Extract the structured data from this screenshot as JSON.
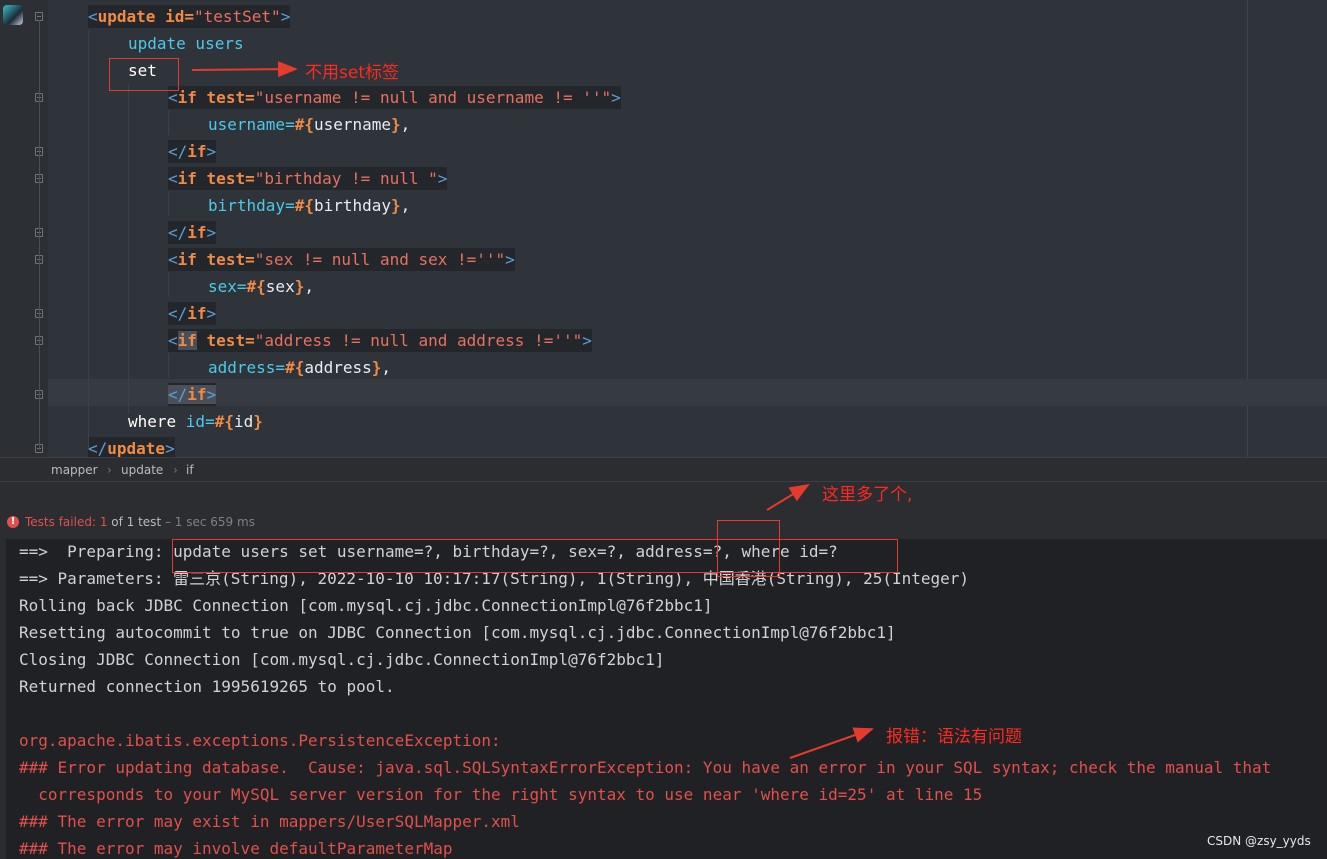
{
  "editor": {
    "lines": [
      {
        "parts": [
          {
            "t": "<",
            "c": "t-br"
          },
          {
            "t": "update ",
            "c": "t-tag"
          },
          {
            "t": "id=",
            "c": "t-tag"
          },
          {
            "t": "\"testSet\"",
            "c": "t-str"
          },
          {
            "t": ">",
            "c": "t-br"
          }
        ]
      },
      {
        "parts": [
          {
            "t": "update users",
            "c": "t-kw"
          }
        ]
      },
      {
        "parts": [
          {
            "t": "set",
            "c": "t-wh"
          }
        ]
      },
      {
        "parts": [
          {
            "t": "<",
            "c": "t-br"
          },
          {
            "t": "if ",
            "c": "t-tag"
          },
          {
            "t": "test=",
            "c": "t-tag"
          },
          {
            "t": "\"username != null and username != ''\"",
            "c": "t-str"
          },
          {
            "t": ">",
            "c": "t-br"
          }
        ]
      },
      {
        "parts": [
          {
            "t": "username=",
            "c": "t-kw"
          },
          {
            "t": "#{",
            "c": "t-tag"
          },
          {
            "t": "username",
            "c": "t-var"
          },
          {
            "t": "}",
            "c": "t-tag"
          },
          {
            "t": ",",
            "c": "t-var"
          }
        ]
      },
      {
        "parts": [
          {
            "t": "</",
            "c": "t-br"
          },
          {
            "t": "if",
            "c": "t-tag"
          },
          {
            "t": ">",
            "c": "t-br"
          }
        ]
      },
      {
        "parts": [
          {
            "t": "<",
            "c": "t-br"
          },
          {
            "t": "if ",
            "c": "t-tag"
          },
          {
            "t": "test=",
            "c": "t-tag"
          },
          {
            "t": "\"birthday != null \"",
            "c": "t-str"
          },
          {
            "t": ">",
            "c": "t-br"
          }
        ]
      },
      {
        "parts": [
          {
            "t": "birthday=",
            "c": "t-kw"
          },
          {
            "t": "#{",
            "c": "t-tag"
          },
          {
            "t": "birthday",
            "c": "t-var"
          },
          {
            "t": "}",
            "c": "t-tag"
          },
          {
            "t": ",",
            "c": "t-var"
          }
        ]
      },
      {
        "parts": [
          {
            "t": "</",
            "c": "t-br"
          },
          {
            "t": "if",
            "c": "t-tag"
          },
          {
            "t": ">",
            "c": "t-br"
          }
        ]
      },
      {
        "parts": [
          {
            "t": "<",
            "c": "t-br"
          },
          {
            "t": "if ",
            "c": "t-tag"
          },
          {
            "t": "test=",
            "c": "t-tag"
          },
          {
            "t": "\"sex != null and sex !=''\"",
            "c": "t-str"
          },
          {
            "t": ">",
            "c": "t-br"
          }
        ]
      },
      {
        "parts": [
          {
            "t": "sex=",
            "c": "t-kw"
          },
          {
            "t": "#{",
            "c": "t-tag"
          },
          {
            "t": "sex",
            "c": "t-var"
          },
          {
            "t": "}",
            "c": "t-tag"
          },
          {
            "t": ",",
            "c": "t-var"
          }
        ]
      },
      {
        "parts": [
          {
            "t": "</",
            "c": "t-br"
          },
          {
            "t": "if",
            "c": "t-tag"
          },
          {
            "t": ">",
            "c": "t-br"
          }
        ]
      },
      {
        "parts": [
          {
            "t": "<",
            "c": "t-br"
          },
          {
            "t": "if",
            "c": "t-tag t-hl"
          },
          {
            "t": " test=",
            "c": "t-tag"
          },
          {
            "t": "\"address != null and address !=''\"",
            "c": "t-str"
          },
          {
            "t": ">",
            "c": "t-br"
          }
        ]
      },
      {
        "parts": [
          {
            "t": "address=",
            "c": "t-kw"
          },
          {
            "t": "#{",
            "c": "t-tag"
          },
          {
            "t": "address",
            "c": "t-var"
          },
          {
            "t": "}",
            "c": "t-tag"
          },
          {
            "t": ",",
            "c": "t-var"
          }
        ]
      },
      {
        "parts": [
          {
            "t": "</",
            "c": "t-br t-hl"
          },
          {
            "t": "if",
            "c": "t-tag t-hl"
          },
          {
            "t": ">",
            "c": "t-br t-hl"
          }
        ]
      },
      {
        "parts": [
          {
            "t": "where ",
            "c": "t-wh"
          },
          {
            "t": "id=",
            "c": "t-kw"
          },
          {
            "t": "#{",
            "c": "t-tag"
          },
          {
            "t": "id",
            "c": "t-var"
          },
          {
            "t": "}",
            "c": "t-tag"
          }
        ]
      },
      {
        "parts": [
          {
            "t": "</",
            "c": "t-br"
          },
          {
            "t": "update",
            "c": "t-tag"
          },
          {
            "t": ">",
            "c": "t-br"
          }
        ]
      }
    ]
  },
  "breadcrumb": {
    "items": [
      "mapper",
      "update",
      "if"
    ]
  },
  "testbar": {
    "status": "Tests failed: ",
    "count": "1",
    "of": " of 1 test",
    "time": " – 1 sec 659 ms"
  },
  "console": {
    "lines": [
      {
        "text": "==>  Preparing: update users set username=?, birthday=?, sex=?, address=?, where id=?",
        "err": false
      },
      {
        "text": "==> Parameters: 雷三京(String), 2022-10-10 10:17:17(String), 1(String), 中国香港(String), 25(Integer)",
        "err": false
      },
      {
        "text": "Rolling back JDBC Connection [com.mysql.cj.jdbc.ConnectionImpl@76f2bbc1]",
        "err": false
      },
      {
        "text": "Resetting autocommit to true on JDBC Connection [com.mysql.cj.jdbc.ConnectionImpl@76f2bbc1]",
        "err": false
      },
      {
        "text": "Closing JDBC Connection [com.mysql.cj.jdbc.ConnectionImpl@76f2bbc1]",
        "err": false
      },
      {
        "text": "Returned connection 1995619265 to pool.",
        "err": false
      },
      {
        "text": "",
        "err": false
      },
      {
        "text": "org.apache.ibatis.exceptions.PersistenceException:",
        "err": true
      },
      {
        "text": "### Error updating database.  Cause: java.sql.SQLSyntaxErrorException: You have an error in your SQL syntax; check the manual that",
        "err": true
      },
      {
        "text": "  corresponds to your MySQL server version for the right syntax to use near 'where id=25' at line 15",
        "err": true
      },
      {
        "text": "### The error may exist in mappers/UserSQLMapper.xml",
        "err": true
      },
      {
        "text": "### The error may involve defaultParameterMap",
        "err": true
      }
    ]
  },
  "annotations": {
    "a1": "不用set标签",
    "a2": "这里多了个,",
    "a3": "报错：语法有问题"
  },
  "watermark": "CSDN @zsy_yyds",
  "colors": {
    "accent_red": "#e53b2e",
    "error_text": "#e2504b"
  }
}
